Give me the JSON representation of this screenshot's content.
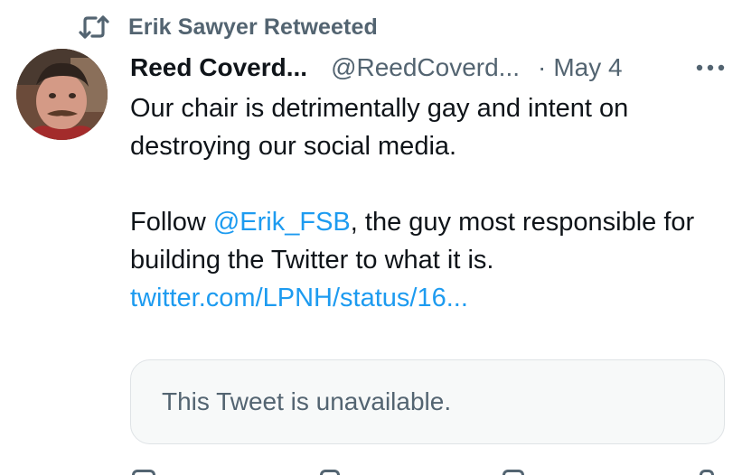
{
  "retweet": {
    "label": "Erik Sawyer Retweeted",
    "icon": "retweet-icon"
  },
  "tweet": {
    "display_name": "Reed Coverd...",
    "handle": "@ReedCoverd...",
    "separator": "·",
    "date": "May 4",
    "avatar": "user-avatar",
    "more_icon": "more-horizontal-icon",
    "text_line1": "Our chair is detrimentally gay and intent on",
    "text_line2": "destroying our social media.",
    "follow_prefix": "Follow ",
    "mention": "@Erik_FSB",
    "follow_suffix": ", the guy most responsible for",
    "text_line4": "building the Twitter to what it is.",
    "link": "twitter.com/LPNH/status/16..."
  },
  "quoted": {
    "unavailable_text": "This Tweet is unavailable."
  },
  "colors": {
    "text": "#0f1419",
    "secondary": "#536471",
    "link": "#1d9bf0",
    "card_bg": "#f7f9f9",
    "card_border": "#dfe3e6"
  }
}
